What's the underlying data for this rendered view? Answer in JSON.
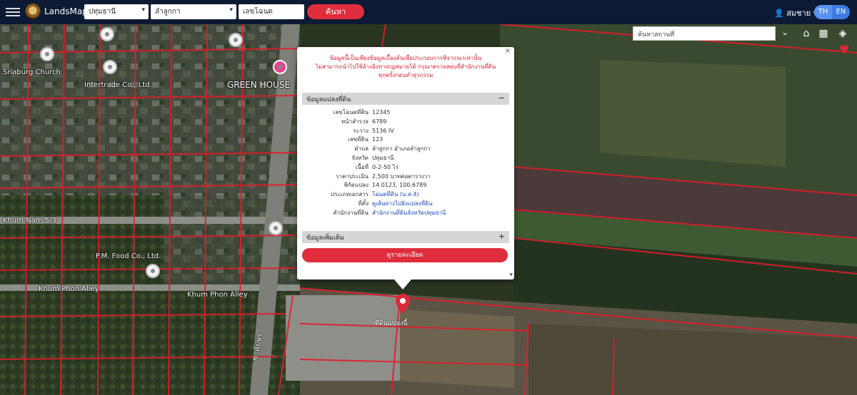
{
  "header": {
    "brand": "LandsMaps",
    "province_value": "ปทุมธานี",
    "district_value": "ลำลูกกา",
    "parcel_value": "เลขโฉนด",
    "search_label": "ค้นหา",
    "user_name": "สมชาย",
    "lang_th": "TH",
    "lang_en": "EN"
  },
  "map": {
    "search_placeholder": "ค้นหาสถานที่",
    "labels": {
      "church": "Sriaburg Church",
      "intertrade": "Intertrade Co., Ltd.",
      "greenhouse": "GREEN HOUSE",
      "alley_1": "Khum Nam 5/3",
      "food": "P.M. Food Co., Ltd.",
      "alley_2": "Khum Phon Alley",
      "alley_3": "Khum Phon Alley",
      "road": "ซ. คุ้มพร",
      "marker_label": "ที่ดินแปลงนี้"
    }
  },
  "popup": {
    "alert_line1": "ข้อมูลนี้เป็นเพียงข้อมูลเบื้องต้นเพื่อประกอบการพิจารณาเท่านั้น",
    "alert_line2": "ไม่สามารถนำไปใช้อ้างอิงทางกฎหมายได้ กรุณาตรวจสอบที่สำนักงานที่ดิน",
    "alert_line3": "ทุกครั้งก่อนทำธุรกรรม",
    "section1": "ข้อมูลแปลงที่ดิน",
    "section1_toggle": "−",
    "rows": [
      {
        "k": "เลขโฉนดที่ดิน",
        "v": "12345"
      },
      {
        "k": "หน้าสำรวจ",
        "v": "6789"
      },
      {
        "k": "ระวาง",
        "v": "5136 IV"
      },
      {
        "k": "เลขที่ดิน",
        "v": "123"
      },
      {
        "k": "ตำบล",
        "v": "ลำลูกกา อำเภอลำลูกกา"
      },
      {
        "k": "จังหวัด",
        "v": "ปทุมธานี"
      },
      {
        "k": "เนื้อที่",
        "v": "0-2-50 ไร่"
      },
      {
        "k": "ราคาประเมิน",
        "v": "2,500 บาทต่อตารางวา"
      },
      {
        "k": "พิกัดแปลง",
        "v": "14.0123, 100.6789"
      },
      {
        "k": "ประเภทเอกสาร",
        "v": "โฉนดที่ดิน (น.ส.4)"
      },
      {
        "k": "ที่ตั้ง",
        "v": "ดูเส้นทางไปยังแปลงที่ดิน"
      },
      {
        "k": "สำนักงานที่ดิน",
        "v": "สำนักงานที่ดินจังหวัดปทุมธานี"
      }
    ],
    "section2": "ข้อมูลเพิ่มเติม",
    "section2_toggle": "+",
    "detail_button": "ดูรายละเอียด"
  }
}
